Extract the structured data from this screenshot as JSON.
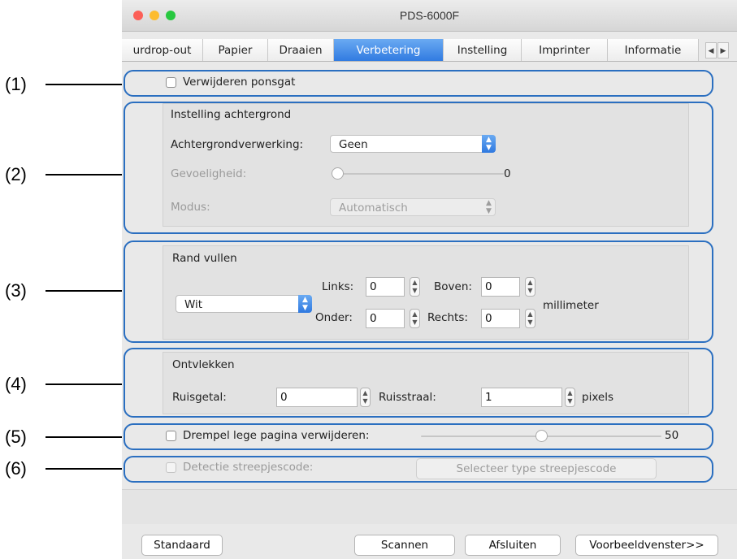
{
  "callouts": [
    "(1)",
    "(2)",
    "(3)",
    "(4)",
    "(5)",
    "(6)"
  ],
  "window": {
    "title": "PDS-6000F",
    "traffic_lights": {
      "close": "#fc5f57",
      "minimize": "#fdbc2e",
      "zoom": "#28c840"
    }
  },
  "tabs": [
    {
      "label": "urdrop-out"
    },
    {
      "label": "Papier"
    },
    {
      "label": "Draaien"
    },
    {
      "label": "Verbetering",
      "active": true
    },
    {
      "label": "Instelling"
    },
    {
      "label": "Imprinter"
    },
    {
      "label": "Informatie"
    }
  ],
  "tab_scroll": {
    "left": "◀",
    "right": "▶"
  },
  "punch_hole": {
    "label": "Verwijderen ponsgat",
    "checked": false
  },
  "background": {
    "title": "Instelling achtergrond",
    "processing_label": "Achtergrondverwerking:",
    "processing_value": "Geen",
    "sensitivity_label": "Gevoeligheid:",
    "sensitivity_value": "0",
    "mode_label": "Modus:",
    "mode_value": "Automatisch"
  },
  "edge_fill": {
    "title": "Rand vullen",
    "color_value": "Wit",
    "left_label": "Links:",
    "left_value": "0",
    "top_label": "Boven:",
    "top_value": "0",
    "bottom_label": "Onder:",
    "bottom_value": "0",
    "right_label": "Rechts:",
    "right_value": "0",
    "unit": "millimeter"
  },
  "despeckle": {
    "title": "Ontvlekken",
    "noise_count_label": "Ruisgetal:",
    "noise_count_value": "0",
    "noise_radius_label": "Ruisstraal:",
    "noise_radius_value": "1",
    "unit": "pixels"
  },
  "blank_page": {
    "label": "Drempel lege pagina verwijderen:",
    "checked": false,
    "value": "50",
    "level_fraction": 0.5
  },
  "barcode": {
    "label": "Detectie streepjescode:",
    "checked": false,
    "button": "Selecteer type streepjescode"
  },
  "footer": {
    "default_button": "Standaard",
    "scan_button": "Scannen",
    "close_button": "Afsluiten",
    "preview_button": "Voorbeeldvenster>>"
  },
  "colors": {
    "accent": "#2f79e0",
    "highlight_border": "#2b6fc0"
  }
}
